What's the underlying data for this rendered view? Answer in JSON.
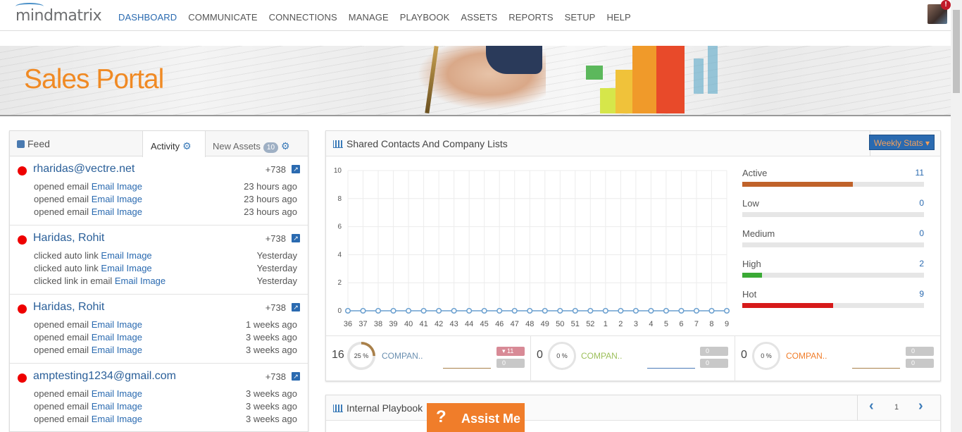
{
  "brand": {
    "logo_text": "mindmatrix"
  },
  "nav": {
    "items": [
      {
        "label": "DASHBOARD",
        "active": true
      },
      {
        "label": "COMMUNICATE"
      },
      {
        "label": "CONNECTIONS"
      },
      {
        "label": "MANAGE"
      },
      {
        "label": "PLAYBOOK"
      },
      {
        "label": "ASSETS"
      },
      {
        "label": "REPORTS"
      },
      {
        "label": "SETUP"
      },
      {
        "label": "HELP"
      }
    ],
    "notification_badge": "!"
  },
  "banner": {
    "title": "Sales Portal"
  },
  "feed_panel": {
    "tab_feed": "Feed",
    "tab_activity": "Activity",
    "tab_new_assets": "New Assets",
    "new_assets_count": "10",
    "items": [
      {
        "name": "rharidas@vectre.net",
        "score": "+738",
        "lines": [
          {
            "action": "opened email",
            "link": "Email Image",
            "time": "23 hours ago"
          },
          {
            "action": "opened email",
            "link": "Email Image",
            "time": "23 hours ago"
          },
          {
            "action": "opened email",
            "link": "Email Image",
            "time": "23 hours ago"
          }
        ]
      },
      {
        "name": "Haridas, Rohit",
        "score": "+738",
        "lines": [
          {
            "action": "clicked auto link",
            "link": "Email Image",
            "time": "Yesterday"
          },
          {
            "action": "clicked auto link",
            "link": "Email Image",
            "time": "Yesterday"
          },
          {
            "action": "clicked link in email",
            "link": "Email Image",
            "time": "Yesterday"
          }
        ]
      },
      {
        "name": "Haridas, Rohit",
        "score": "+738",
        "lines": [
          {
            "action": "opened email",
            "link": "Email Image",
            "time": "1 weeks ago"
          },
          {
            "action": "opened email",
            "link": "Email Image",
            "time": "3 weeks ago"
          },
          {
            "action": "opened email",
            "link": "Email Image",
            "time": "3 weeks ago"
          }
        ]
      },
      {
        "name": "amptesting1234@gmail.com",
        "score": "+738",
        "lines": [
          {
            "action": "opened email",
            "link": "Email Image",
            "time": "3 weeks ago"
          },
          {
            "action": "opened email",
            "link": "Email Image",
            "time": "3 weeks ago"
          },
          {
            "action": "opened email",
            "link": "Email Image",
            "time": "3 weeks ago"
          }
        ]
      }
    ]
  },
  "shared_contacts": {
    "title": "Shared Contacts And Company Lists",
    "weekly_stats_label": "Weekly Stats",
    "stats": [
      {
        "label": "Active",
        "value": "11",
        "fraction": 0.61,
        "color": "#c0622a"
      },
      {
        "label": "Low",
        "value": "0",
        "fraction": 0,
        "color": "#c0622a"
      },
      {
        "label": "Medium",
        "value": "0",
        "fraction": 0,
        "color": "#c0622a"
      },
      {
        "label": "High",
        "value": "2",
        "fraction": 0.11,
        "color": "#3aaa35"
      },
      {
        "label": "Hot",
        "value": "9",
        "fraction": 0.5,
        "color": "#d61a1a"
      }
    ],
    "summary": [
      {
        "count": "16",
        "percent": "25 %",
        "name": "COMPAN..",
        "name_color": "#6a8fb0",
        "up": "11",
        "down": "0",
        "ring_fraction": 0.25,
        "ring_color": "#a9804a",
        "spark_color": "#a9804a"
      },
      {
        "count": "0",
        "percent": "0 %",
        "name": "COMPAN..",
        "name_color": "#9cbf5a",
        "up": "0",
        "down": "0",
        "ring_fraction": 0,
        "ring_color": "#e4e4e4",
        "spark_color": "#4a7ab8"
      },
      {
        "count": "0",
        "percent": "0 %",
        "name": "COMPAN..",
        "name_color": "#f07d2a",
        "up": "0",
        "down": "0",
        "ring_fraction": 0,
        "ring_color": "#e4e4e4",
        "spark_color": "#a9804a"
      }
    ]
  },
  "chart_data": {
    "type": "line",
    "x": [
      "36",
      "37",
      "38",
      "39",
      "40",
      "41",
      "42",
      "43",
      "44",
      "45",
      "46",
      "47",
      "48",
      "49",
      "50",
      "51",
      "52",
      "1",
      "2",
      "3",
      "4",
      "5",
      "6",
      "7",
      "8",
      "9"
    ],
    "series": [
      {
        "values": [
          0,
          0,
          0,
          0,
          0,
          0,
          0,
          0,
          0,
          0,
          0,
          0,
          0,
          0,
          0,
          0,
          0,
          0,
          0,
          0,
          0,
          0,
          0,
          0,
          0,
          0
        ],
        "color": "#6a9fcf"
      }
    ],
    "yticks": [
      "0",
      "2",
      "4",
      "6",
      "8",
      "10"
    ],
    "ylim": [
      0,
      10
    ],
    "grid": true
  },
  "playbook": {
    "title": "Internal Playbook",
    "page": "1"
  },
  "assist": {
    "label": "Assist Me",
    "icon": "?"
  }
}
